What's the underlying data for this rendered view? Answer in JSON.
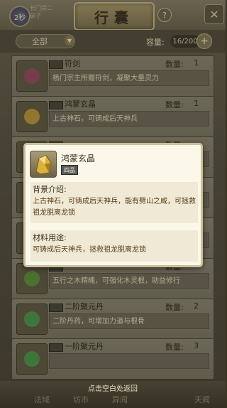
{
  "header": {
    "level": "2秒",
    "player_line1": "长门宗二",
    "player_line2": "弟子",
    "title": "行囊",
    "help": "?",
    "close": "✕"
  },
  "filter": {
    "selected": "全部",
    "capacity_label": "容量:",
    "capacity_value": "16/200",
    "add": "+"
  },
  "qty_label": "数量:",
  "items": [
    {
      "name": "符剑",
      "qty": "1",
      "desc": "杨门宗主所赠符剑，凝聚大量灵力",
      "color": "#a0486a"
    },
    {
      "name": "鸿蒙玄晶",
      "qty": "1",
      "desc": "上古神石，可铸成后天神兵",
      "color": "#c9a43a"
    },
    {
      "name": "",
      "qty": "",
      "desc": "",
      "color": "#888"
    },
    {
      "name": "",
      "qty": "",
      "desc": "",
      "color": "#888"
    },
    {
      "name": "",
      "qty": "",
      "desc": "",
      "color": "#888"
    },
    {
      "name": "",
      "qty": "",
      "desc": "五行之木精魄，可强化木灵根，助益修行",
      "color": "#5a9a3a"
    },
    {
      "name": "二阶聚元丹",
      "qty": "2",
      "desc": "二阶丹药，可增加力道与根骨",
      "color": "#4aa24a"
    },
    {
      "name": "一阶聚元丹",
      "qty": "3",
      "desc": "",
      "color": "#4aa24a"
    }
  ],
  "popup": {
    "name": "鸿蒙玄晶",
    "grade": "四品",
    "background_title": "背景介绍:",
    "background_text": "上古神石，可铸成后天神兵，能有劈山之威，可拯救祖龙脱离龙锁",
    "use_title": "材料用途:",
    "use_text": "可铸成后天神兵，拯救祖龙脱离龙锁"
  },
  "bottom": {
    "hint": "点击空白处返回",
    "nav": [
      "法域",
      "坊市",
      "异闻",
      "天闻"
    ]
  },
  "colors": {
    "popup_bg": "#fbf8ea",
    "accent_text": "#5a3e1a"
  }
}
